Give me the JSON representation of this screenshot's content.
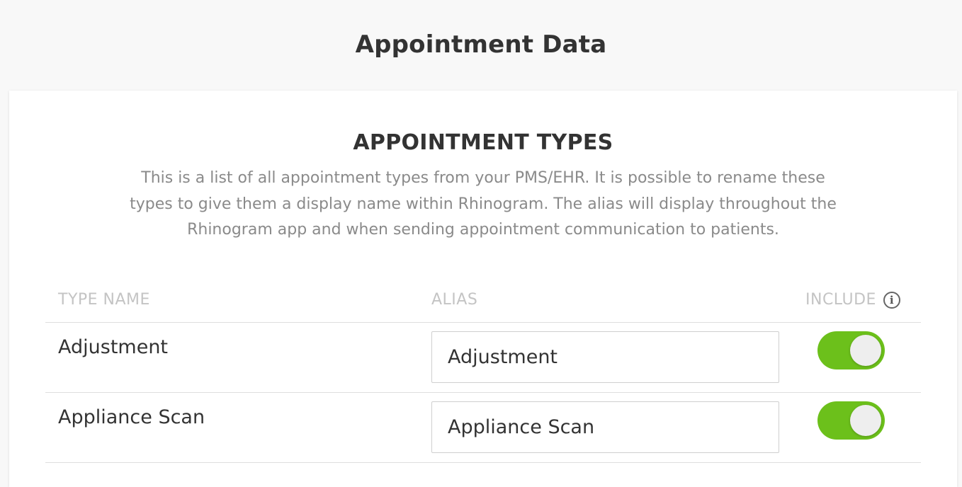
{
  "page": {
    "title": "Appointment Data"
  },
  "section": {
    "title": "APPOINTMENT TYPES",
    "description": "This is a list of all appointment types from your PMS/EHR. It is possible to rename these types to give them a display name within Rhinogram. The alias will display throughout the Rhinogram app and when sending appointment communication to patients."
  },
  "table": {
    "columns": {
      "type_name": "TYPE NAME",
      "alias": "ALIAS",
      "include": "INCLUDE",
      "include_icon": "info-icon"
    },
    "rows": [
      {
        "type_name": "Adjustment",
        "alias": "Adjustment",
        "include": true
      },
      {
        "type_name": "Appliance Scan",
        "alias": "Appliance Scan",
        "include": true
      }
    ]
  },
  "colors": {
    "toggle_on": "#6cc01b",
    "header_text": "#c4c4c4",
    "description_text": "#8a8a8a"
  }
}
